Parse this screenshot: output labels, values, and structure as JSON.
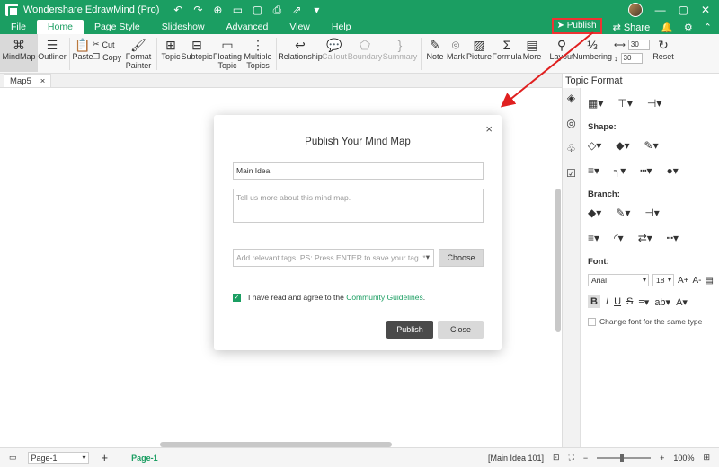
{
  "app": {
    "title": "Wondershare EdrawMind (Pro)",
    "quick_access": [
      "↶",
      "↷",
      "⊕",
      "▭",
      "▢",
      "▤",
      "⎙",
      "⇗",
      "▾"
    ],
    "window_controls": [
      "—",
      "▢",
      "✕"
    ]
  },
  "menu": {
    "items": [
      "File",
      "Home",
      "Page Style",
      "Slideshow",
      "Advanced",
      "View",
      "Help"
    ],
    "active": "Home",
    "publish_label": "Publish",
    "share_label": "Share"
  },
  "ribbon": {
    "mindmap": "MindMap",
    "outliner": "Outliner",
    "paste": "Paste",
    "cut": "Cut",
    "copy": "Copy",
    "format_painter_1": "Format",
    "format_painter_2": "Painter",
    "topic": "Topic",
    "subtopic": "Subtopic",
    "floating_1": "Floating",
    "floating_2": "Topic",
    "multiple_1": "Multiple",
    "multiple_2": "Topics",
    "relationship": "Relationship",
    "callout": "Callout",
    "boundary": "Boundary",
    "summary": "Summary",
    "note": "Note",
    "mark": "Mark",
    "picture": "Picture",
    "formula": "Formula",
    "more": "More",
    "layout": "Layout",
    "numbering": "Numbering",
    "spacing_h": "30",
    "spacing_v": "30",
    "reset": "Reset"
  },
  "doc_tab": {
    "name": "Map5",
    "close": "×"
  },
  "panel": {
    "title": "Topic Format",
    "shape_label": "Shape:",
    "branch_label": "Branch:",
    "font_label": "Font:",
    "font_family": "Arial",
    "font_size": "18",
    "change_font_all": "Change font for the same type"
  },
  "dialog": {
    "title": "Publish Your Mind Map",
    "name_value": "Main Idea",
    "description_placeholder": "Tell us more about this mind map.",
    "tags_placeholder": "Add relevant tags. PS: Press ENTER to save your tag. *",
    "choose_label": "Choose",
    "agree_text": "I have read and agree to the",
    "agree_link": "Community Guidelines",
    "agree_end": ".",
    "publish_label": "Publish",
    "close_label": "Close",
    "x_label": "×"
  },
  "status": {
    "page_select": "Page-1",
    "page_tab": "Page-1",
    "selection": "[Main Idea 101]",
    "zoom": "100%"
  },
  "colors": {
    "accent": "#1b9e62",
    "annotation_arrow": "#e02020"
  }
}
